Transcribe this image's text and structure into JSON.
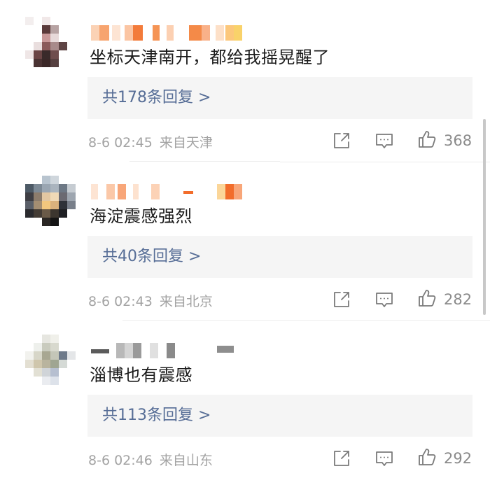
{
  "colors": {
    "reply_link": "#566d96",
    "meta_text": "#a3a3a3",
    "reply_bg": "#f5f5f5",
    "icon_stroke": "#7a7a7a"
  },
  "comments": [
    {
      "text": "坐标天津南开，都给我摇晃醒了",
      "reply_label": "共178条回复 >",
      "time": "8-6 02:45",
      "location": "来自天津",
      "likes": "368"
    },
    {
      "text": "海淀震感强烈",
      "reply_label": "共40条回复 >",
      "time": "8-6 02:43",
      "location": "来自北京",
      "likes": "282"
    },
    {
      "text": "淄博也有震感",
      "reply_label": "共113条回复 >",
      "time": "8-6 02:46",
      "location": "来自山东",
      "likes": "292"
    }
  ],
  "icons": {
    "share": "share-icon",
    "comment": "comment-icon",
    "like": "thumbs-up-icon"
  }
}
